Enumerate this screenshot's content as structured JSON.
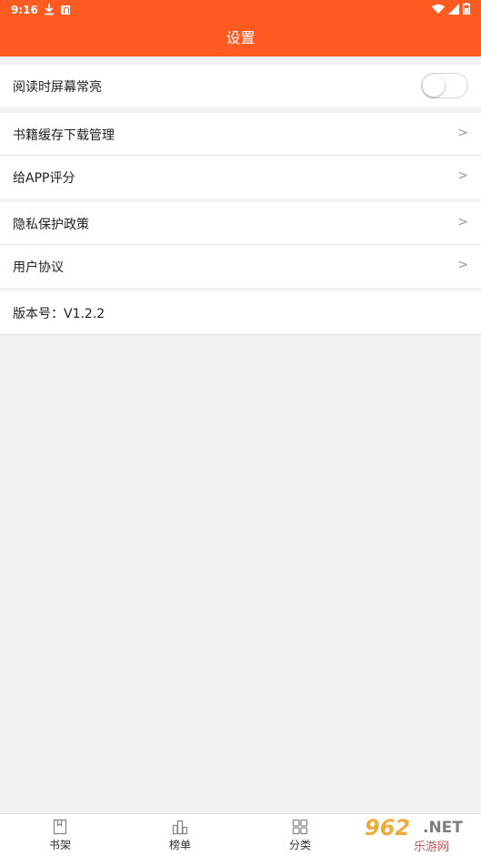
{
  "status_bar": {
    "time": "9:16",
    "icons": [
      "download-icon",
      "accessibility-icon",
      "wifi-icon",
      "signal-icon",
      "battery-icon"
    ]
  },
  "app_bar": {
    "title": "设置"
  },
  "settings": {
    "keep_screen_on": {
      "label": "阅读时屏幕常亮",
      "enabled": false
    },
    "cache_download": {
      "label": "书籍缓存下载管理",
      "chevron": ">"
    },
    "rate_app": {
      "label": "给APP评分",
      "chevron": ">"
    },
    "privacy_policy": {
      "label": "隐私保护政策",
      "chevron": ">"
    },
    "user_agreement": {
      "label": "用户协议",
      "chevron": ">"
    },
    "version": {
      "label": "版本号：V1.2.2"
    }
  },
  "tabs": [
    {
      "label": "书架",
      "icon": "bookshelf-icon"
    },
    {
      "label": "榜单",
      "icon": "ranking-icon"
    },
    {
      "label": "分类",
      "icon": "category-icon"
    }
  ],
  "watermark": {
    "number": "962",
    "suffix": ".NET",
    "subtitle": "乐游网"
  },
  "colors": {
    "accent": "#ff5a1f",
    "background": "#f2f2f2"
  }
}
